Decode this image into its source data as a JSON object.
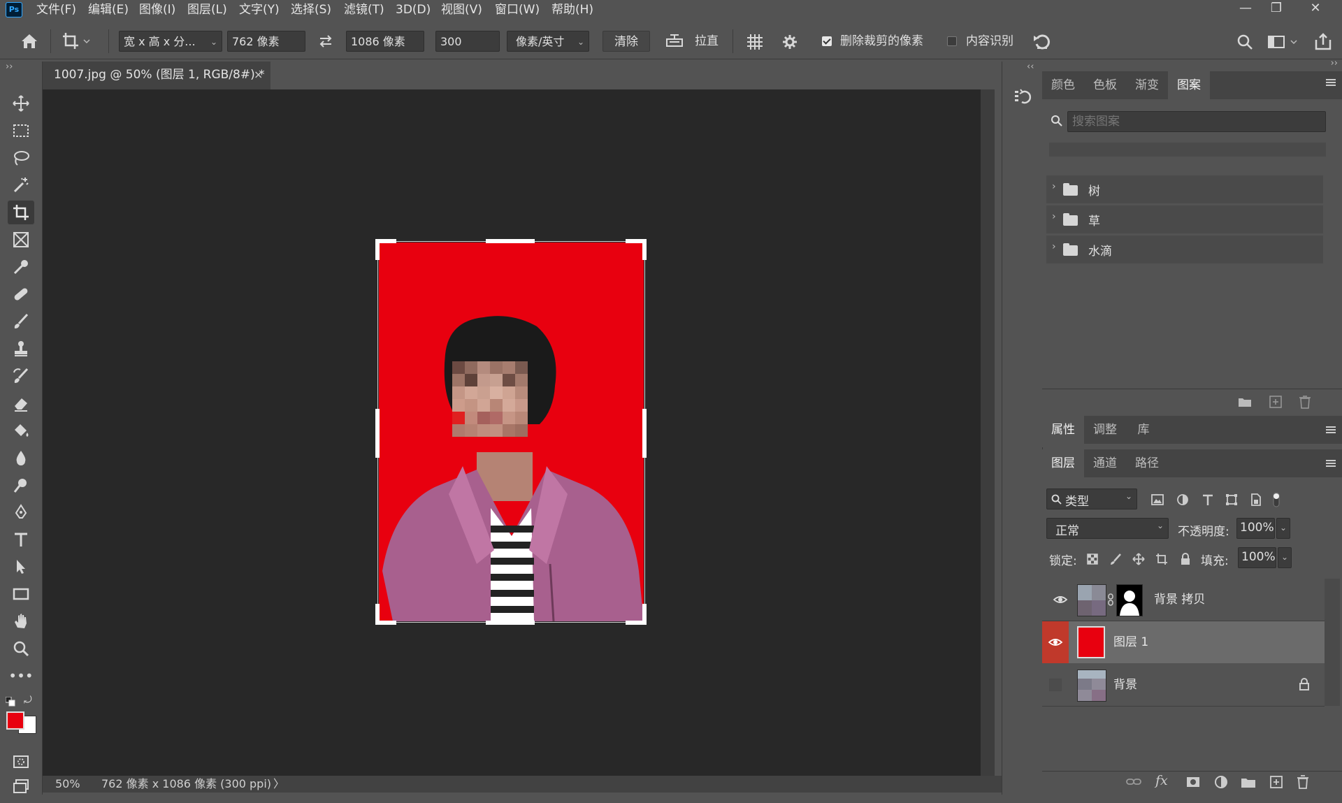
{
  "app": {
    "logo": "Ps"
  },
  "menu": [
    "文件(F)",
    "编辑(E)",
    "图像(I)",
    "图层(L)",
    "文字(Y)",
    "选择(S)",
    "滤镜(T)",
    "3D(D)",
    "视图(V)",
    "窗口(W)",
    "帮助(H)"
  ],
  "window_controls": {
    "minimize": "—",
    "restore": "❐",
    "close": "✕"
  },
  "options_bar": {
    "ratio_preset": "宽 x 高 x 分...",
    "width_value": "762 像素",
    "height_value": "1086 像素",
    "resolution_value": "300",
    "resolution_unit": "像素/英寸",
    "clear_label": "清除",
    "straighten_label": "拉直",
    "delete_cropped_label": "删除裁剪的像素",
    "delete_cropped_checked": true,
    "content_aware_label": "内容识别",
    "content_aware_checked": false
  },
  "document": {
    "tab_title": "1007.jpg @ 50% (图层 1, RGB/8#) *",
    "tab_close": "×",
    "zoom": "50%",
    "status_info": "762 像素 x 1086 像素 (300 ppi)",
    "status_arrow": "〉",
    "background_color": "#e8000f"
  },
  "pattern_panel": {
    "tabs": [
      "颜色",
      "色板",
      "渐变",
      "图案"
    ],
    "active_tab": "图案",
    "search_placeholder": "搜索图案",
    "groups": [
      "树",
      "草",
      "水滴"
    ]
  },
  "properties_panel": {
    "tabs": [
      "属性",
      "调整",
      "库"
    ],
    "active_tab": "属性"
  },
  "layers_panel": {
    "tabs": [
      "图层",
      "通道",
      "路径"
    ],
    "active_tab": "图层",
    "filter_kind": "类型",
    "blend_mode": "正常",
    "opacity_label": "不透明度:",
    "opacity_value": "100%",
    "lock_label": "锁定:",
    "fill_label": "填充:",
    "fill_value": "100%",
    "layers": [
      {
        "name": "背景 拷贝",
        "visible": true,
        "selected": false,
        "has_mask": true,
        "locked": false
      },
      {
        "name": "图层 1",
        "visible": true,
        "selected": true,
        "has_mask": false,
        "locked": false
      },
      {
        "name": "背景",
        "visible": false,
        "selected": false,
        "has_mask": false,
        "locked": true
      }
    ]
  },
  "colors": {
    "foreground": "#e8000f",
    "background": "#ffffff",
    "accent_selected_eye": "#c0392b"
  }
}
